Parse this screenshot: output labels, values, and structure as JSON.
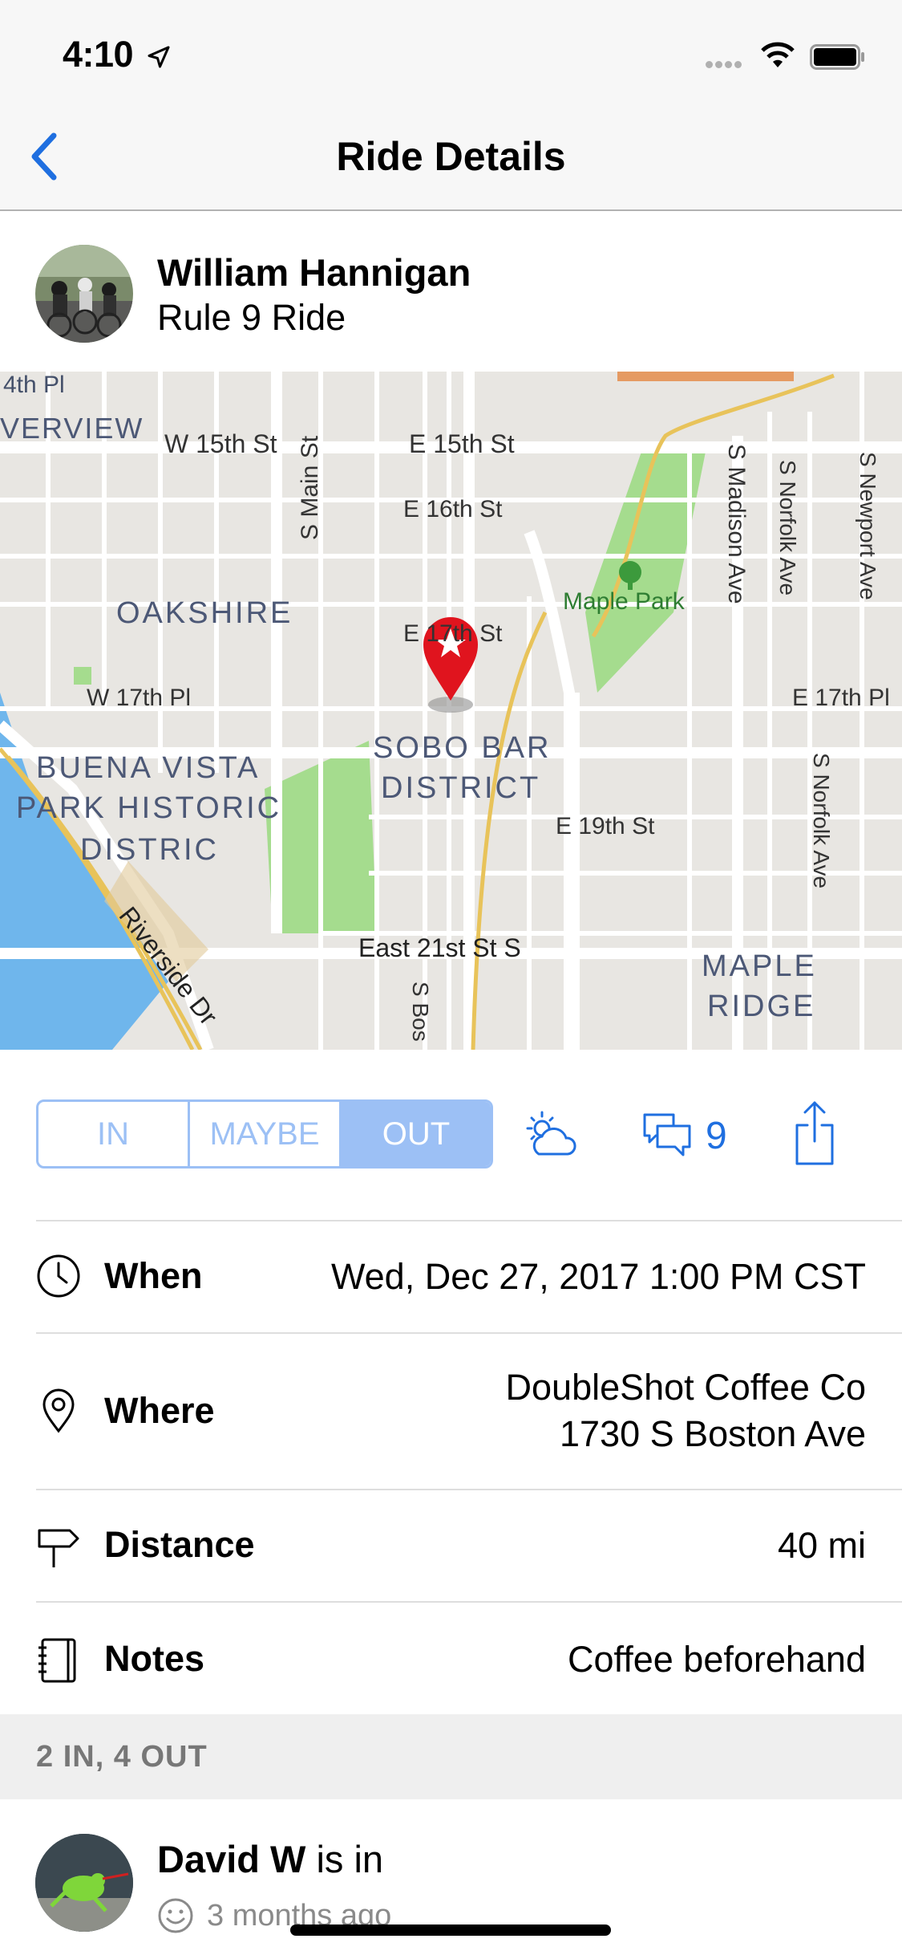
{
  "status_bar": {
    "time": "4:10"
  },
  "nav": {
    "title": "Ride Details",
    "back_icon": "chevron-left-icon"
  },
  "ride": {
    "host_name": "William Hannigan",
    "ride_name": "Rule 9 Ride"
  },
  "map": {
    "labels": {
      "fourth_pl": "4th Pl",
      "riverview": "VERVIEW",
      "w15": "W 15th St",
      "e15": "E 15th St",
      "e16": "E 16th St",
      "main": "S Main St",
      "oakshire": "OAKSHIRE",
      "maple_park": "Maple Park",
      "madison": "S Madison Ave",
      "norfolk": "S Norfolk Ave",
      "newport": "S Newport Ave",
      "e17st": "E 17th St",
      "w17": "W 17th Pl",
      "e17pl": "E 17th Pl",
      "sobo1": "SOBO BAR",
      "sobo2": "DISTRICT",
      "buena1": "BUENA VISTA",
      "buena2": "PARK HISTORIC",
      "buena3": "DISTRIC",
      "e19": "E 19th St",
      "norfolk2": "S Norfolk Ave",
      "riverside": "Riverside Dr",
      "e21": "East 21st St S",
      "sbos": "S Bos",
      "maple_ridge1": "MAPLE",
      "maple_ridge2": "RIDGE"
    }
  },
  "rsvp": {
    "options": [
      "IN",
      "MAYBE",
      "OUT"
    ],
    "selected": "OUT",
    "comment_count": "9"
  },
  "details": {
    "when": {
      "label": "When",
      "value": "Wed, Dec 27, 2017 1:00 PM CST"
    },
    "where": {
      "label": "Where",
      "value_line1": "DoubleShot Coffee Co",
      "value_line2": "1730 S Boston Ave"
    },
    "distance": {
      "label": "Distance",
      "value": "40 mi"
    },
    "notes": {
      "label": "Notes",
      "value": "Coffee beforehand"
    }
  },
  "attendance": {
    "summary": "2 IN, 4 OUT",
    "people": [
      {
        "name": "David W",
        "status": " is in",
        "time": "3 months ago"
      }
    ]
  },
  "colors": {
    "accent": "#1f6fe0",
    "segment": "#9cc0f5",
    "pin": "#e0141e"
  }
}
